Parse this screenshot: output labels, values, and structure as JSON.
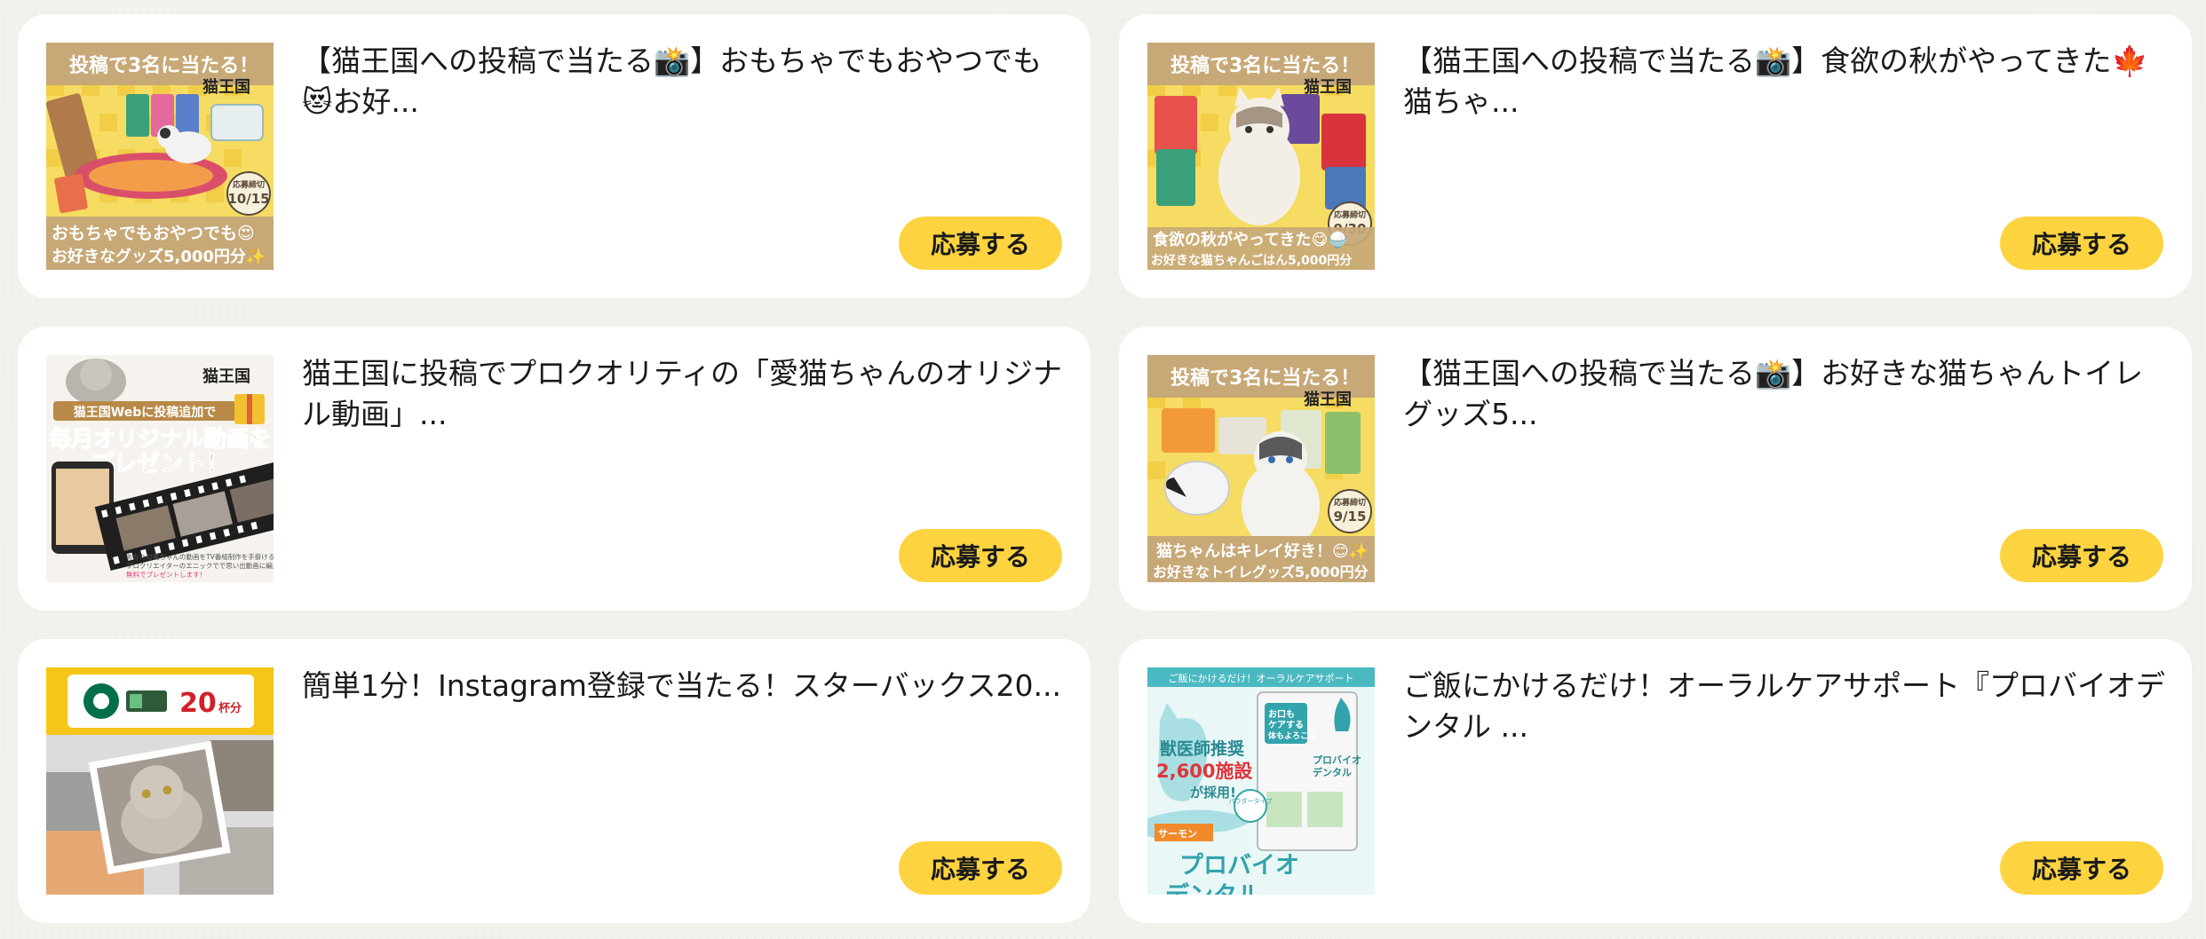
{
  "campaigns": [
    {
      "title": "【猫王国への投稿で当たる📸】おもちゃでもおやつでも😻お好...",
      "button_label": "応募する",
      "image": {
        "banner": "投稿で3名に当たる！",
        "logo": "猫王国",
        "caption_line1": "おもちゃでもおやつでも😍",
        "caption_line2": "お好きなグッズ5,000円分✨",
        "deadline_label": "応募締切",
        "deadline": "10/15"
      }
    },
    {
      "title": "【猫王国への投稿で当たる📸】食欲の秋がやってきた🍁猫ちゃ...",
      "button_label": "応募する",
      "image": {
        "banner": "投稿で3名に当たる！",
        "logo": "猫王国",
        "caption_line1": "食欲の秋がやってきた😋🍚",
        "caption_line2": "お好きな猫ちゃんごはん5,000円分",
        "deadline_label": "応募締切",
        "deadline": "9/30"
      }
    },
    {
      "title": "猫王国に投稿でプロクオリティの「愛猫ちゃんのオリジナル動画」...",
      "button_label": "応募する",
      "image": {
        "logo": "猫王国",
        "ribbon": "猫王国Webに投稿追加で",
        "headline_line1": "毎月オリジナル動画を",
        "headline_line2": "プレゼント！",
        "fineprint_line1": "あなたの猫ちゃんの動画をTV番組制作を手掛ける",
        "fineprint_line2": "プロクリエイターのエニックでで思い出動画に編集し、",
        "fineprint_line3": "無料でプレゼントします！"
      }
    },
    {
      "title": "【猫王国への投稿で当たる📸】お好きな猫ちゃんトイレグッズ5...",
      "button_label": "応募する",
      "image": {
        "banner": "投稿で3名に当たる！",
        "logo": "猫王国",
        "caption_line1": "猫ちゃんはキレイ好き！😊✨",
        "caption_line2": "お好きなトイレグッズ5,000円分",
        "deadline_label": "応募締切",
        "deadline": "9/15"
      }
    },
    {
      "title": "簡単1分！Instagram登録で当たる！スターバックス20...",
      "button_label": "応募する",
      "image": {
        "count": "20",
        "unit": "杯分"
      }
    },
    {
      "title": "ご飯にかけるだけ！オーラルケアサポート『プロバイオデンタル ...",
      "button_label": "応募する",
      "image": {
        "top_strip": "ご飯にかけるだけ！オーラルケアサポート",
        "endorse_line1": "獣医師推奨",
        "endorse_line2": "2,600施設",
        "endorse_line3": "が採用!",
        "pack_line1": "お口も",
        "pack_line2": "ケアする",
        "pack_line3": "体もよろこぶ",
        "pack_name_line1": "プロバイオ",
        "pack_name_line2": "デンタル",
        "powder": "パウダータイプ",
        "salmon": "サーモン",
        "brand_line1": "プロバイオ",
        "brand_line2": "デンタル"
      }
    }
  ],
  "colors": {
    "button_yellow": "#fdd440",
    "promo_yellow": "#f4d44c",
    "promo_tan": "#c7a877",
    "teal": "#4bb9c2"
  }
}
